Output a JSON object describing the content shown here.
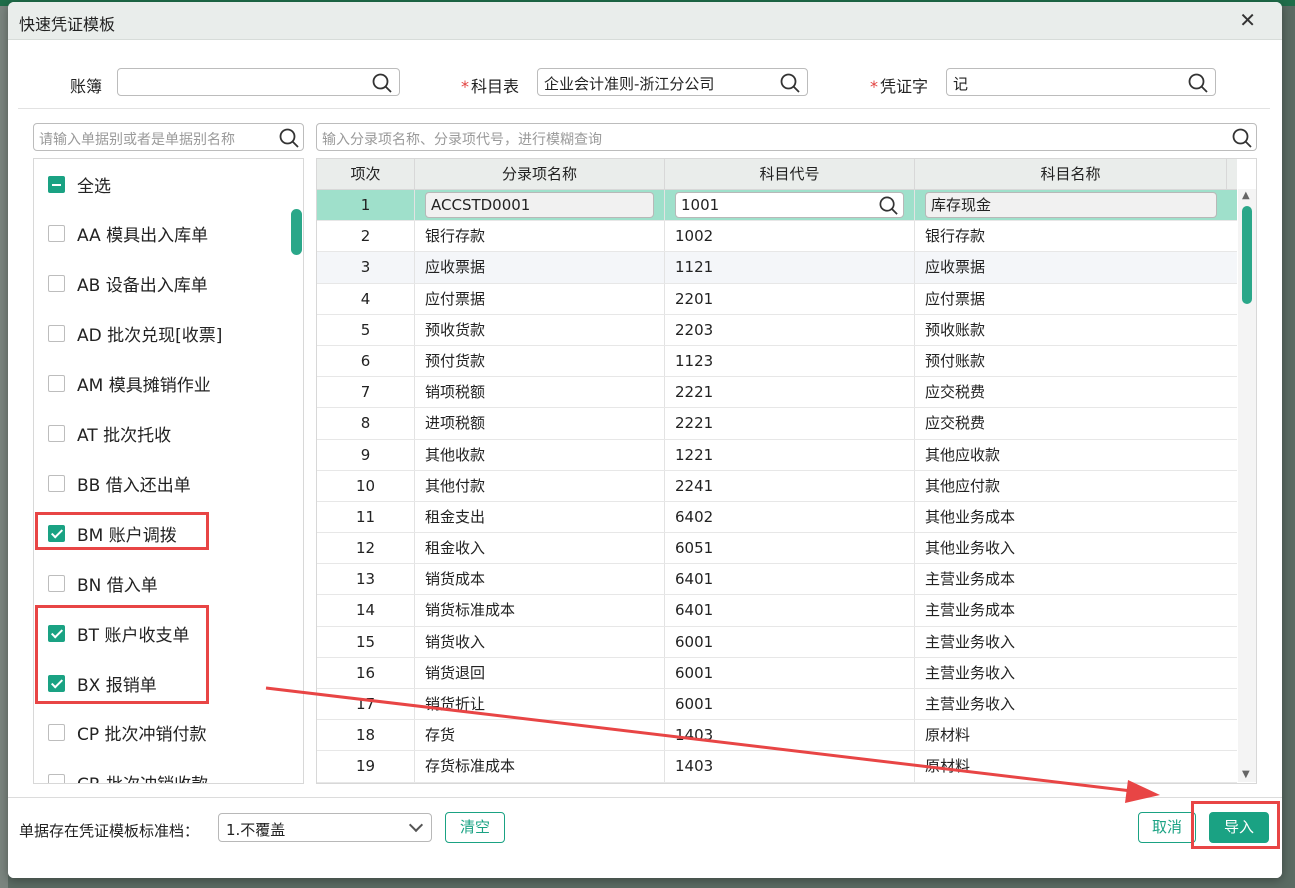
{
  "dialog": {
    "title": "快速凭证模板",
    "close": "✕"
  },
  "fields": {
    "book": {
      "label": "账簿",
      "value": ""
    },
    "chart": {
      "label": "科目表",
      "value": "企业会计准则-浙江分公司"
    },
    "voucher": {
      "label": "凭证字",
      "value": "记"
    }
  },
  "left_search": {
    "placeholder": "请输入单据别或者是单据别名称"
  },
  "main_search": {
    "placeholder": "输入分录项名称、分录项代号，进行模糊查询"
  },
  "doc_list": [
    {
      "label": "全选",
      "state": "indeterminate"
    },
    {
      "label": "AA 模具出入库单",
      "state": "off"
    },
    {
      "label": "AB 设备出入库单",
      "state": "off"
    },
    {
      "label": "AD 批次兑现[收票]",
      "state": "off"
    },
    {
      "label": "AM 模具摊销作业",
      "state": "off"
    },
    {
      "label": "AT 批次托收",
      "state": "off"
    },
    {
      "label": "BB 借入还出单",
      "state": "off"
    },
    {
      "label": "BM 账户调拨",
      "state": "on"
    },
    {
      "label": "BN 借入单",
      "state": "off"
    },
    {
      "label": "BT 账户收支单",
      "state": "on"
    },
    {
      "label": "BX 报销单",
      "state": "on"
    },
    {
      "label": "CP 批次冲销付款",
      "state": "off"
    },
    {
      "label": "CR 批次冲销收款",
      "state": "off"
    }
  ],
  "table": {
    "headers": [
      "项次",
      "分录项名称",
      "科目代号",
      "科目名称"
    ],
    "rows": [
      [
        "1",
        "ACCSTD0001",
        "1001",
        "库存现金"
      ],
      [
        "2",
        "银行存款",
        "1002",
        "银行存款"
      ],
      [
        "3",
        "应收票据",
        "1121",
        "应收票据"
      ],
      [
        "4",
        "应付票据",
        "2201",
        "应付票据"
      ],
      [
        "5",
        "预收货款",
        "2203",
        "预收账款"
      ],
      [
        "6",
        "预付货款",
        "1123",
        "预付账款"
      ],
      [
        "7",
        "销项税额",
        "2221",
        "应交税费"
      ],
      [
        "8",
        "进项税额",
        "2221",
        "应交税费"
      ],
      [
        "9",
        "其他收款",
        "1221",
        "其他应收款"
      ],
      [
        "10",
        "其他付款",
        "2241",
        "其他应付款"
      ],
      [
        "11",
        "租金支出",
        "6402",
        "其他业务成本"
      ],
      [
        "12",
        "租金收入",
        "6051",
        "其他业务收入"
      ],
      [
        "13",
        "销货成本",
        "6401",
        "主营业务成本"
      ],
      [
        "14",
        "销货标准成本",
        "6401",
        "主营业务成本"
      ],
      [
        "15",
        "销货收入",
        "6001",
        "主营业务收入"
      ],
      [
        "16",
        "销货退回",
        "6001",
        "主营业务收入"
      ],
      [
        "17",
        "销货折让",
        "6001",
        "主营业务收入"
      ],
      [
        "18",
        "存货",
        "1403",
        "原材料"
      ],
      [
        "19",
        "存货标准成本",
        "1403",
        "原材料"
      ]
    ]
  },
  "footer": {
    "label": "单据存在凭证模板标准档：",
    "select_value": "1.不覆盖",
    "clear_label": "清空",
    "cancel_label": "取消",
    "import_label": "导入"
  },
  "colors": {
    "accent": "#1aa283",
    "selected_row": "#9fe0cb",
    "annotation": "#e84545"
  }
}
